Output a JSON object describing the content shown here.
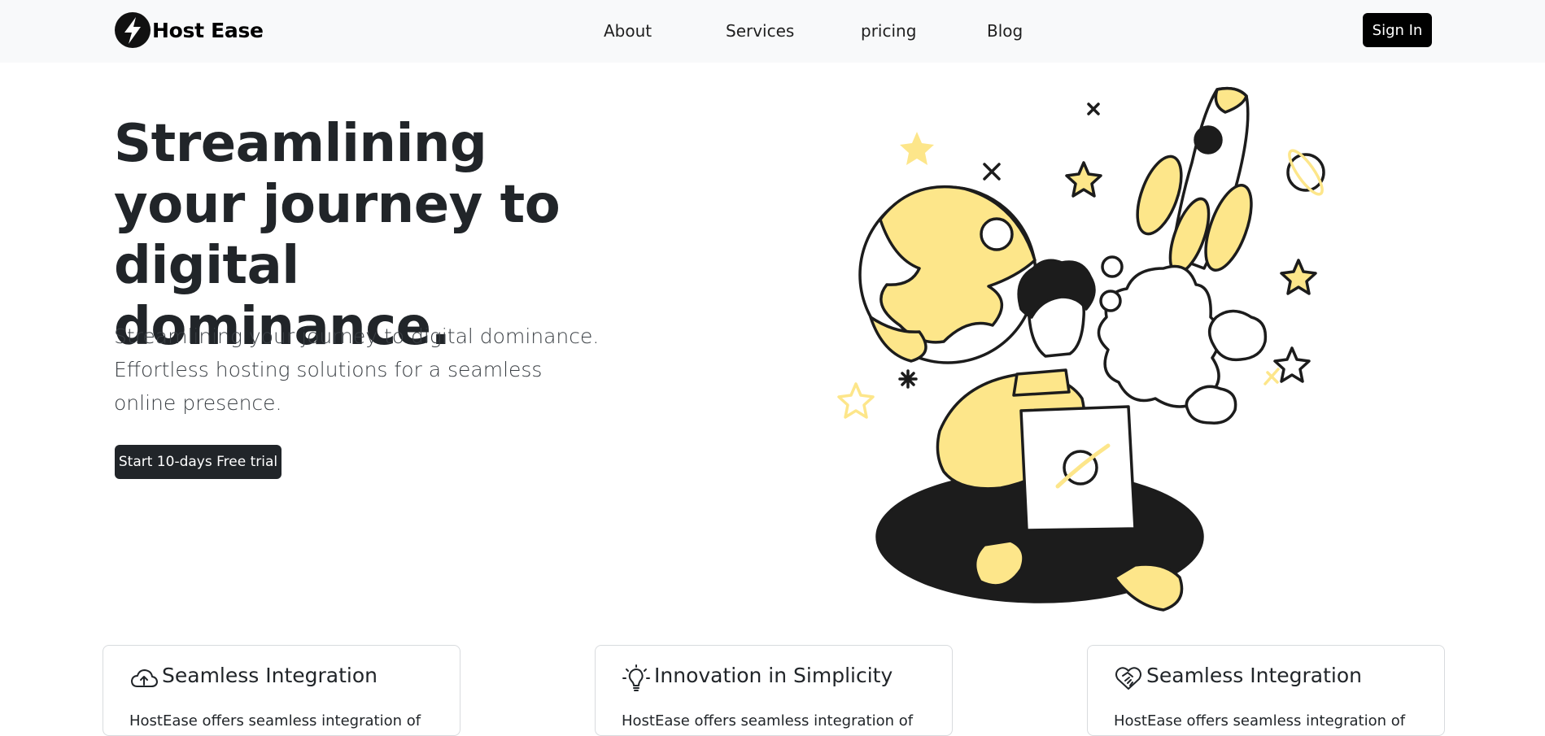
{
  "brand": {
    "name": "Host Ease",
    "icon": "lightning-bolt-icon"
  },
  "nav": {
    "links": [
      "About",
      "Services",
      "pricing",
      "Blog"
    ],
    "signin_label": "Sign In"
  },
  "hero": {
    "title": "Streamlining your journey to digital dominance.",
    "lead": "Streamlining your journey to digital dominance. Effortless hosting solutions for a seamless online presence.",
    "cta_label": "Start 10-days Free trial",
    "illustration": "person-with-laptop-rocket-illustration"
  },
  "features": [
    {
      "icon": "cloud-upload-icon",
      "title": "Seamless Integration",
      "text": "HostEase offers seamless integration of"
    },
    {
      "icon": "lightbulb-icon",
      "title": "Innovation in Simplicity",
      "text": "HostEase offers seamless integration of"
    },
    {
      "icon": "heart-handshake-icon",
      "title": "Seamless Integration",
      "text": "HostEase offers seamless integration of"
    }
  ],
  "colors": {
    "accent_yellow": "#fde68a",
    "ink": "#1c1c1c",
    "button_dark": "#212529",
    "navbar_bg": "#f8f9fa"
  }
}
